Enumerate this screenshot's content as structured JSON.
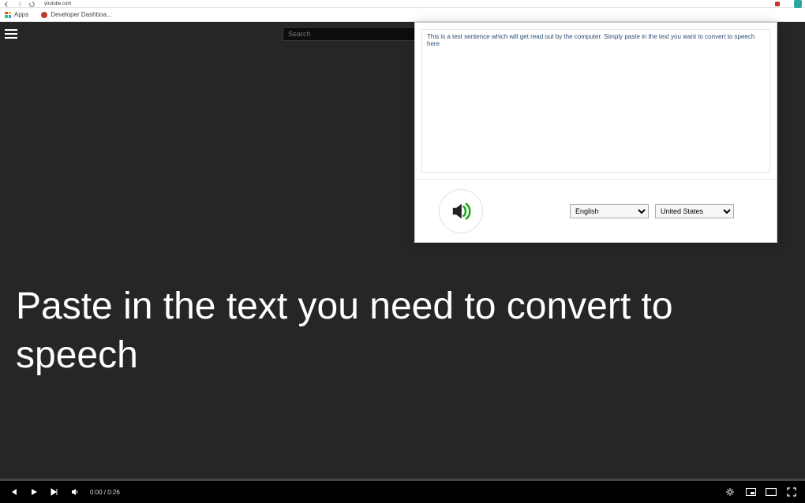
{
  "browser": {
    "url": "youtube.com",
    "bookmarks": {
      "apps": "Apps",
      "dev": "Developer Dashboa..."
    }
  },
  "yt": {
    "search_placeholder": "Search"
  },
  "caption": "Paste in the text you need to convert to speech",
  "player": {
    "time": "0:00 / 0:26"
  },
  "popup": {
    "text_value": "This is a test sentence which will get read out by the computer. Simply paste in the text you want to convert to speech here",
    "language_selected": "English",
    "region_selected": "United States"
  }
}
